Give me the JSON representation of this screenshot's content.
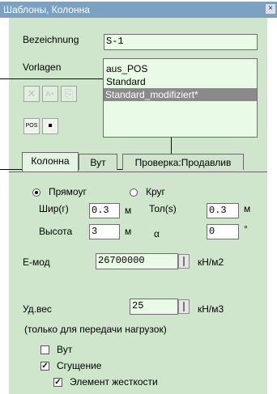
{
  "window": {
    "title": "Шаблоны, Колонна",
    "close_glyph": "×"
  },
  "designation": {
    "label": "Bezeichnung",
    "value": "S-1"
  },
  "templates": {
    "label": "Vorlagen",
    "items": [
      "aus_POS",
      "Standard",
      "Standard_modifiziert*"
    ],
    "selected_index": 2
  },
  "toolbar": {
    "delete_glyph": "✕",
    "add_glyph": "A+",
    "copy_glyph": "⎘",
    "import_glyph": "POS",
    "save_glyph": "▪"
  },
  "tabs": [
    "Колонна",
    "Вут",
    "Проверка:Продавлив"
  ],
  "shape": {
    "rect_label": "Прямоуг",
    "round_label": "Круг",
    "selected": "rect"
  },
  "dims": {
    "width_label": "Шир(г)",
    "width_value": "0.3",
    "width_unit": "м",
    "thickness_label": "Тол(s)",
    "thickness_value": "0.3",
    "thickness_unit": "м",
    "height_label": "Высота",
    "height_value": "3",
    "height_unit": "м",
    "alpha_label": "α",
    "alpha_value": "0",
    "alpha_unit": "°"
  },
  "emod": {
    "label": "Е-мод",
    "value": "26700000",
    "unit": "кН/м2"
  },
  "weight": {
    "label": "Уд.вес",
    "value": "25",
    "unit": "кН/м3"
  },
  "note": "(только для передачи нагрузок)",
  "checks": {
    "vut_label": "Вут",
    "vut_checked": false,
    "thick_label": "Сгущение",
    "thick_checked": true,
    "rigid_label": "Элемент жесткости",
    "rigid_checked": true
  },
  "check_mark": "✓"
}
